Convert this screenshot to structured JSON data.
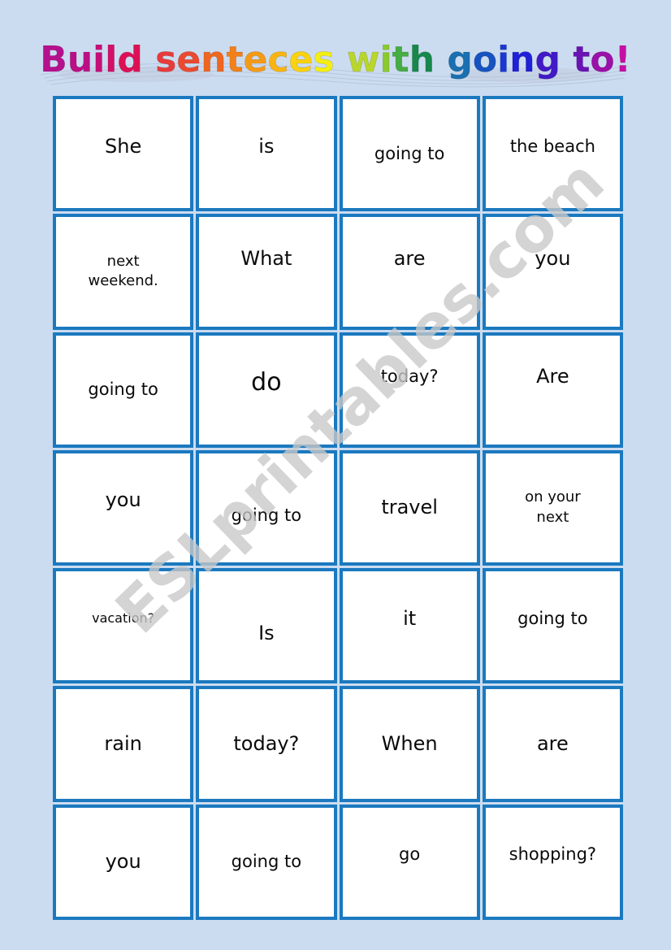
{
  "page": {
    "background_color": "#ccdcf0",
    "card_border_color": "#1b79bf",
    "card_fill_color": "#ffffff",
    "text_color": "#0a0a0a"
  },
  "title": {
    "full_text": "Build senteces with going to!",
    "style": "rainbow-wordart",
    "letters": [
      {
        "ch": "B",
        "color": "#b5108e"
      },
      {
        "ch": "u",
        "color": "#bb0f86"
      },
      {
        "ch": "i",
        "color": "#c60f78"
      },
      {
        "ch": "l",
        "color": "#d20f69"
      },
      {
        "ch": "d",
        "color": "#dd1055"
      },
      {
        "ch": " ",
        "color": "#dd1055"
      },
      {
        "ch": "s",
        "color": "#e83b3b"
      },
      {
        "ch": "e",
        "color": "#ea4a30"
      },
      {
        "ch": "n",
        "color": "#ee6620"
      },
      {
        "ch": "t",
        "color": "#f1801a"
      },
      {
        "ch": "e",
        "color": "#f59a16"
      },
      {
        "ch": "c",
        "color": "#f8b412"
      },
      {
        "ch": "e",
        "color": "#fbd20d"
      },
      {
        "ch": "s",
        "color": "#f5ee12"
      },
      {
        "ch": " ",
        "color": "#f5ee12"
      },
      {
        "ch": "w",
        "color": "#b9d62a"
      },
      {
        "ch": "i",
        "color": "#8ac92f"
      },
      {
        "ch": "t",
        "color": "#46ad44"
      },
      {
        "ch": "h",
        "color": "#17874b"
      },
      {
        "ch": " ",
        "color": "#17874b"
      },
      {
        "ch": "g",
        "color": "#1a6fb0"
      },
      {
        "ch": "o",
        "color": "#1753c0"
      },
      {
        "ch": "i",
        "color": "#1a38cf"
      },
      {
        "ch": "n",
        "color": "#2020d8"
      },
      {
        "ch": "g",
        "color": "#4119c6"
      },
      {
        "ch": " ",
        "color": "#4119c6"
      },
      {
        "ch": "t",
        "color": "#6a12b4"
      },
      {
        "ch": "o",
        "color": "#9a10a8"
      },
      {
        "ch": "!",
        "color": "#c50fa3"
      }
    ]
  },
  "watermark": {
    "text": "ESLprintables.com",
    "color": "#c9c9c9"
  },
  "grid": {
    "columns": 4,
    "rows": 7,
    "cards": [
      {
        "text": "She",
        "size": "sz-lg",
        "nudge": "v-up-sm"
      },
      {
        "text": "is",
        "size": "sz-lg",
        "nudge": "v-up-sm"
      },
      {
        "text": "going to",
        "size": "sz-md",
        "nudge": ""
      },
      {
        "text": "the beach",
        "size": "sz-md",
        "nudge": "v-up-sm"
      },
      {
        "text": "next\nweekend.",
        "size": "sz-sm",
        "nudge": ""
      },
      {
        "text": "What",
        "size": "sz-lg",
        "nudge": "v-up"
      },
      {
        "text": "are",
        "size": "sz-lg",
        "nudge": "v-up"
      },
      {
        "text": "you",
        "size": "sz-lg",
        "nudge": "v-up"
      },
      {
        "text": "going to",
        "size": "sz-md",
        "nudge": ""
      },
      {
        "text": "do",
        "size": "sz-xl",
        "nudge": "v-up-sm"
      },
      {
        "text": "today?",
        "size": "sz-md",
        "nudge": "v-up"
      },
      {
        "text": "Are",
        "size": "sz-lg",
        "nudge": "v-up"
      },
      {
        "text": "you",
        "size": "sz-lg",
        "nudge": "v-up-sm"
      },
      {
        "text": "going to",
        "size": "sz-md",
        "nudge": "v-dn"
      },
      {
        "text": "travel",
        "size": "sz-lg",
        "nudge": ""
      },
      {
        "text": "on your\nnext",
        "size": "sz-sm",
        "nudge": ""
      },
      {
        "text": "vacation?",
        "size": "sz-xs",
        "nudge": "v-up-sm"
      },
      {
        "text": "Is",
        "size": "sz-lg",
        "nudge": "v-dn"
      },
      {
        "text": "it",
        "size": "sz-lg",
        "nudge": "v-up-sm"
      },
      {
        "text": "going to",
        "size": "sz-md",
        "nudge": "v-up-sm"
      },
      {
        "text": "rain",
        "size": "sz-lg",
        "nudge": ""
      },
      {
        "text": "today?",
        "size": "sz-lg",
        "nudge": ""
      },
      {
        "text": "When",
        "size": "sz-lg",
        "nudge": ""
      },
      {
        "text": "are",
        "size": "sz-lg",
        "nudge": ""
      },
      {
        "text": "you",
        "size": "sz-lg",
        "nudge": ""
      },
      {
        "text": "going to",
        "size": "sz-md",
        "nudge": ""
      },
      {
        "text": "go",
        "size": "sz-md",
        "nudge": "v-up-sm"
      },
      {
        "text": "shopping?",
        "size": "sz-md",
        "nudge": "v-up-sm"
      }
    ]
  }
}
